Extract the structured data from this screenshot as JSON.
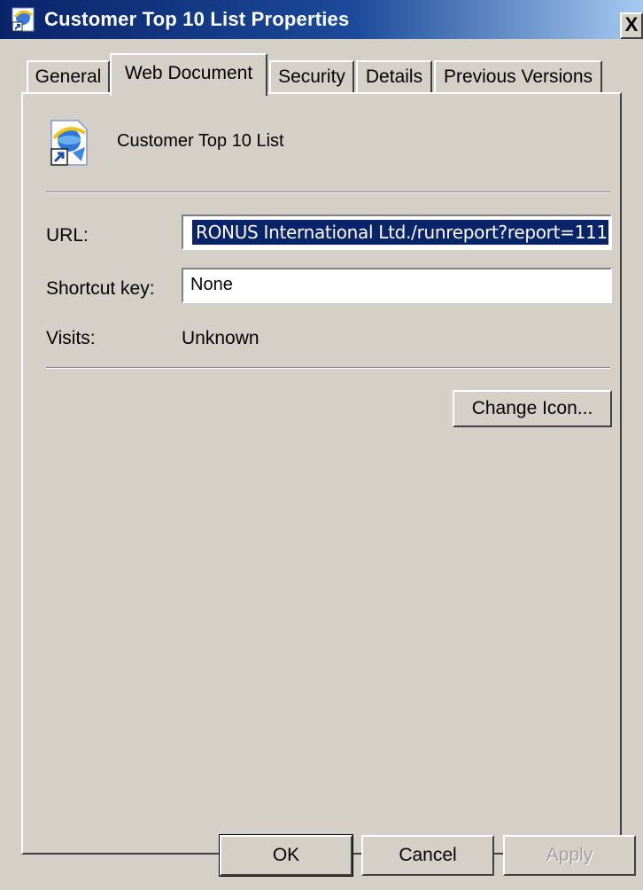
{
  "window": {
    "title": "Customer Top 10 List Properties",
    "close_glyph": "X"
  },
  "tabs": [
    {
      "label": "General",
      "active": false
    },
    {
      "label": "Web Document",
      "active": true
    },
    {
      "label": "Security",
      "active": false
    },
    {
      "label": "Details",
      "active": false
    },
    {
      "label": "Previous Versions",
      "active": false
    }
  ],
  "document": {
    "icon": "internet-shortcut-icon",
    "name": "Customer Top 10 List"
  },
  "fields": {
    "url_label": "URL:",
    "url_value": "RONUS International Ltd./runreport?report=111",
    "shortcut_label": "Shortcut key:",
    "shortcut_value": "None",
    "visits_label": "Visits:",
    "visits_value": "Unknown"
  },
  "buttons": {
    "change_icon": "Change Icon...",
    "ok": "OK",
    "cancel": "Cancel",
    "apply": "Apply"
  },
  "colors": {
    "titlebar_start": "#0a246a",
    "titlebar_end": "#a6caf0",
    "dialog_bg": "#d4d0c8",
    "selection_bg": "#0a246a"
  }
}
